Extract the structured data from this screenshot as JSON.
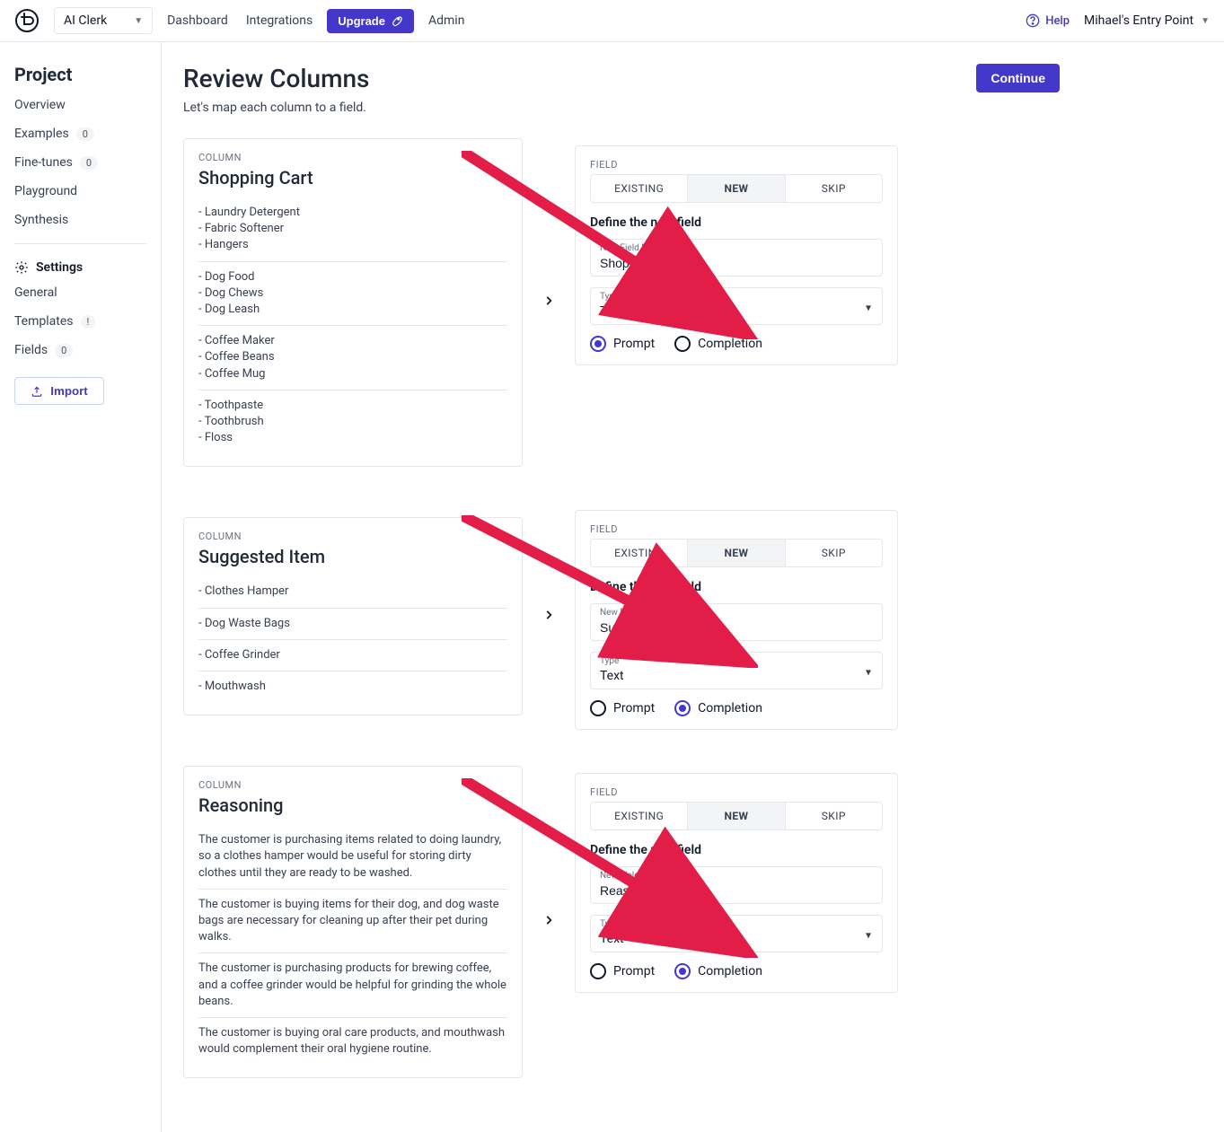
{
  "topbar": {
    "project_name": "AI Clerk",
    "nav": {
      "dashboard": "Dashboard",
      "integrations": "Integrations",
      "admin": "Admin"
    },
    "upgrade": "Upgrade",
    "help": "Help",
    "user": "Mihael's Entry Point"
  },
  "sidebar": {
    "title": "Project",
    "items": [
      {
        "label": "Overview"
      },
      {
        "label": "Examples",
        "badge": "0"
      },
      {
        "label": "Fine-tunes",
        "badge": "0"
      },
      {
        "label": "Playground"
      },
      {
        "label": "Synthesis"
      }
    ],
    "settings_heading": "Settings",
    "settings": [
      {
        "label": "General"
      },
      {
        "label": "Templates",
        "badge": "!"
      },
      {
        "label": "Fields",
        "badge": "0"
      }
    ],
    "import": "Import"
  },
  "page": {
    "title": "Review Columns",
    "subtitle": "Let's map each column to a field.",
    "continue": "Continue"
  },
  "eyebrows": {
    "column": "COLUMN",
    "field": "FIELD"
  },
  "tabs": {
    "existing": "EXISTING",
    "new": "NEW",
    "skip": "SKIP"
  },
  "field_form": {
    "define": "Define the new field",
    "name_label": "New Field Name",
    "type_label": "Type",
    "type_value": "Text",
    "radio_prompt": "Prompt",
    "radio_completion": "Completion"
  },
  "columns": [
    {
      "title": "Shopping Cart",
      "field_name": "Shopping Cart",
      "radio": "prompt",
      "samples": [
        "- Laundry Detergent\n- Fabric Softener\n- Hangers",
        "- Dog Food\n- Dog Chews\n- Dog Leash",
        "- Coffee Maker\n- Coffee Beans\n- Coffee Mug",
        "- Toothpaste\n- Toothbrush\n- Floss"
      ]
    },
    {
      "title": "Suggested Item",
      "field_name": "Suggested Item",
      "radio": "completion",
      "samples": [
        "- Clothes Hamper",
        "- Dog Waste Bags",
        "- Coffee Grinder",
        "- Mouthwash"
      ]
    },
    {
      "title": "Reasoning",
      "field_name": "Reasoning",
      "radio": "completion",
      "samples": [
        "The customer is purchasing items related to doing laundry, so a clothes hamper would be useful for storing dirty clothes until they are ready to be washed.",
        "The customer is buying items for their dog, and dog waste bags are necessary for cleaning up after their pet during walks.",
        "The customer is purchasing products for brewing coffee, and a coffee grinder would be helpful for grinding the whole beans.",
        "The customer is buying oral care products, and mouthwash would complement their oral hygiene routine."
      ]
    }
  ]
}
